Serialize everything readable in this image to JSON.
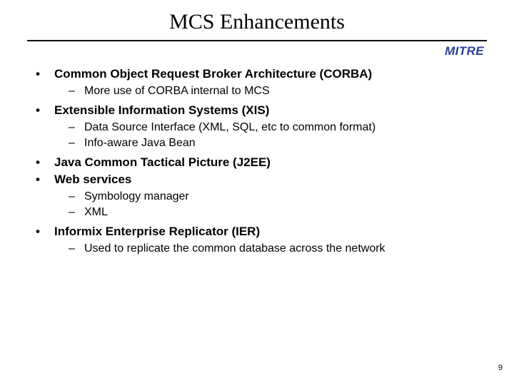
{
  "title": "MCS Enhancements",
  "brand": "MITRE",
  "bullets": {
    "b0": {
      "heading": "Common Object Request Broker Architecture (CORBA)",
      "subs": {
        "s0": "More use of CORBA internal to MCS"
      }
    },
    "b1": {
      "heading": "Extensible Information Systems (XIS)",
      "subs": {
        "s0": "Data Source Interface (XML, SQL, etc to common format)",
        "s1": "Info-aware Java Bean"
      }
    },
    "b2": {
      "heading": "Java Common Tactical Picture (J2EE)"
    },
    "b3": {
      "heading": "Web services",
      "subs": {
        "s0": "Symbology manager",
        "s1": "XML"
      }
    },
    "b4": {
      "heading": "Informix Enterprise Replicator (IER)",
      "subs": {
        "s0": "Used to replicate the common database across the network"
      }
    }
  },
  "pageNum": "9",
  "glyphs": {
    "bullet": "•",
    "dash": "–"
  }
}
